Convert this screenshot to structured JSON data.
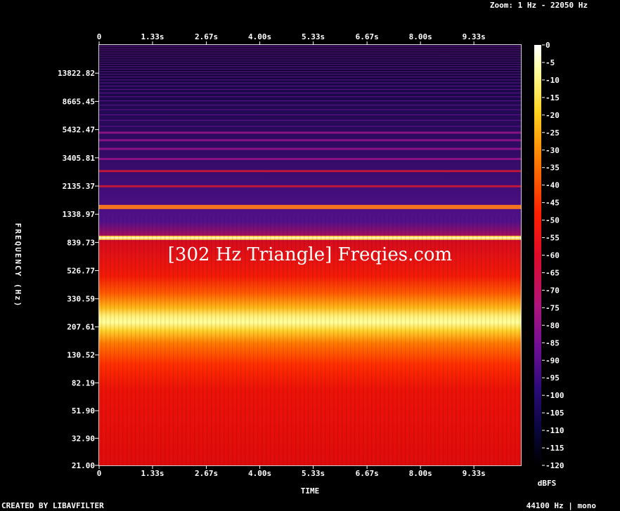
{
  "header": {
    "zoom_text": "Zoom: 1 Hz - 22050 Hz"
  },
  "footer": {
    "credit": "CREATED BY LIBAVFILTER",
    "format": "44100 Hz | mono"
  },
  "watermark": "[302 Hz Triangle] Freqies.com",
  "chart_data": {
    "type": "heatmap",
    "title": "",
    "xlabel": "TIME",
    "ylabel": "FREQUENCY (Hz)",
    "colorbar_label": "dBFS",
    "x_ticks": [
      "0",
      "1.33s",
      "2.67s",
      "4.00s",
      "5.33s",
      "6.67s",
      "8.00s",
      "9.33s"
    ],
    "x_tick_values": [
      0,
      1.33,
      2.67,
      4.0,
      5.33,
      6.67,
      8.0,
      9.33
    ],
    "xlim": [
      0,
      10.5
    ],
    "y_ticks": [
      "13822.82",
      "8665.45",
      "5432.47",
      "3405.81",
      "2135.37",
      "1338.97",
      "839.73",
      "526.77",
      "330.59",
      "207.61",
      "130.52",
      "82.19",
      "51.90",
      "32.90",
      "21.00"
    ],
    "y_tick_values": [
      13822.82,
      8665.45,
      5432.47,
      3405.81,
      2135.37,
      1338.97,
      839.73,
      526.77,
      330.59,
      207.61,
      130.52,
      82.19,
      51.9,
      32.9,
      21.0
    ],
    "ylim": [
      21,
      22050
    ],
    "y_scale": "log",
    "colorbar_ticks": [
      "0",
      "-5",
      "-10",
      "-15",
      "-20",
      "-25",
      "-30",
      "-35",
      "-40",
      "-45",
      "-50",
      "-55",
      "-60",
      "-65",
      "-70",
      "-75",
      "-80",
      "-85",
      "-90",
      "-95",
      "-100",
      "-105",
      "-110",
      "-115",
      "-120"
    ],
    "colorbar_range": [
      -120,
      0
    ],
    "fundamental_hz": 302,
    "harmonics_hz": [
      906,
      1510,
      2114,
      2718,
      3322,
      3926,
      4530,
      5134
    ],
    "colormap": [
      "#000000",
      "#0a0a5c",
      "#4a0a8c",
      "#9a1a9a",
      "#e0101a",
      "#ff2a00",
      "#ff6a00",
      "#ffb000",
      "#ffff40",
      "#ffffff"
    ]
  }
}
